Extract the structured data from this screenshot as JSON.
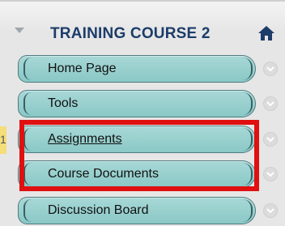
{
  "course": {
    "title": "TRAINING COURSE 2",
    "collapse_icon": "collapse-arrow-icon",
    "home_icon": "home-icon"
  },
  "menu": {
    "items": [
      {
        "label": "Home Page",
        "chevron_icon": "chevron-down-icon"
      },
      {
        "label": "Tools",
        "chevron_icon": "chevron-down-icon"
      },
      {
        "label": "Assignments",
        "chevron_icon": "chevron-down-icon",
        "active": true
      },
      {
        "label": "Course Documents",
        "chevron_icon": "chevron-down-icon"
      },
      {
        "label": "Discussion Board",
        "chevron_icon": "chevron-down-icon"
      }
    ]
  },
  "colors": {
    "item_fill": "#8ac8c6",
    "title_color": "#1c3d6a",
    "highlight": "#e01010"
  }
}
